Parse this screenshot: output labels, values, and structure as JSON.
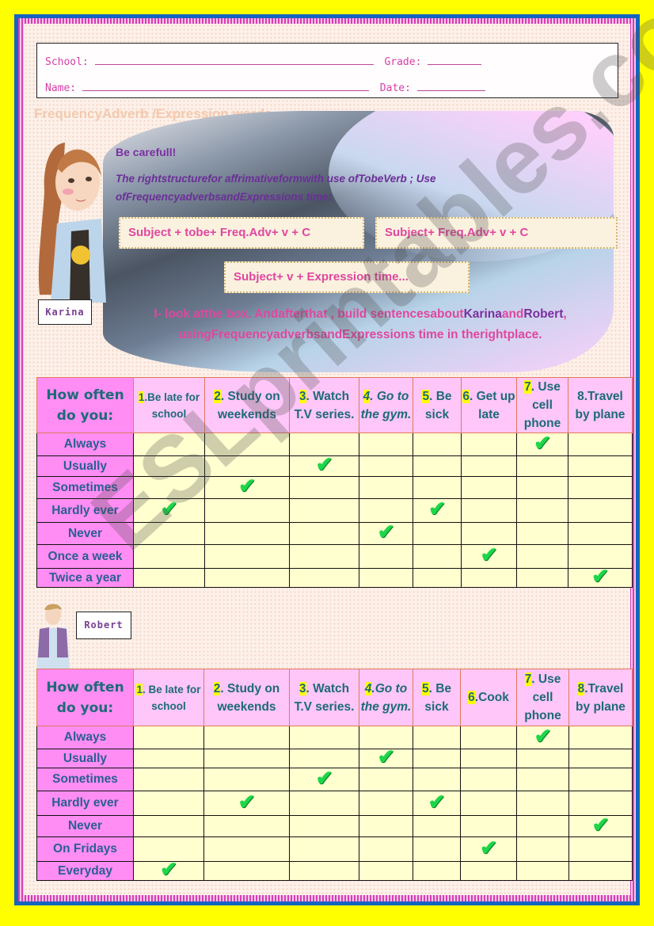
{
  "header": {
    "school_label": "School:",
    "grade_label": "Grade:",
    "name_label": "Name:",
    "date_label": "Date:"
  },
  "section_title": "FrequencyAdverb /Expression  words",
  "banner": {
    "be_careful": "Be carefull!",
    "structure_text": "The rightstructurefor affrimativeformwith use ofTobeVerb ;  Use ofFrequencyadverbsandExpressions time:",
    "formulas": [
      "Subject + tobe+  Freq.Adv+ v + C",
      "Subject+  Freq.Adv+ v + C",
      "Subject+  v +  Expression time..."
    ],
    "instruction": {
      "part1": "I- look atthe box. Andafterthat , build sentencesabout",
      "karina": "Karina",
      "and": "and",
      "robert": "Robert",
      "part2": ", usingFrequencyadverbsandExpressions  time in therightplace."
    }
  },
  "watermark": "ESLprintables.com",
  "check_symbol": "✔",
  "karina": {
    "name": "Karina",
    "corner_label": "How often do you:",
    "columns": [
      {
        "num": "1",
        "text": ".Be late for school"
      },
      {
        "num": "2",
        "text": ". Study on weekends"
      },
      {
        "num": "3",
        "text": ". Watch T.V series."
      },
      {
        "num": "4",
        "text": ". Go to the gym."
      },
      {
        "num": "5",
        "text": ". Be sick"
      },
      {
        "num": "6",
        "text": ". Get up late"
      },
      {
        "num": "7",
        "text": ". Use cell phone"
      },
      {
        "num": "",
        "text": "8.Travel by plane"
      }
    ],
    "rows": [
      {
        "label": "Always",
        "checked_col": 7
      },
      {
        "label": "Usually",
        "checked_col": 3
      },
      {
        "label": "Sometimes",
        "checked_col": 2
      },
      {
        "label": "Hardly ever",
        "checked_cols": [
          1,
          5
        ]
      },
      {
        "label": "Never",
        "checked_col": 4
      },
      {
        "label": "Once a week",
        "checked_col": 6
      },
      {
        "label": "Twice a year",
        "checked_col": 8
      }
    ]
  },
  "robert": {
    "name": "Robert",
    "corner_label": "How often do you:",
    "columns": [
      {
        "num": "1",
        "text": ". Be late for school"
      },
      {
        "num": "2",
        "text": ". Study on weekends"
      },
      {
        "num": "3",
        "text": ". Watch T.V series."
      },
      {
        "num": "4",
        "text": ".Go to the gym."
      },
      {
        "num": "5",
        "text": ". Be sick"
      },
      {
        "num": "6",
        "text": ".Cook"
      },
      {
        "num": "7",
        "text": ". Use cell phone"
      },
      {
        "num": "8",
        "text": ".Travel by plane"
      }
    ],
    "rows": [
      {
        "label": "Always",
        "checked_col": 7
      },
      {
        "label": "Usually",
        "checked_col": 4
      },
      {
        "label": "Sometimes",
        "checked_col": 3
      },
      {
        "label": "Hardly ever",
        "checked_cols": [
          2,
          5
        ]
      },
      {
        "label": "Never",
        "checked_col": 8
      },
      {
        "label": "On Fridays",
        "checked_col": 6
      },
      {
        "label": "Everyday",
        "checked_col": 1
      }
    ]
  }
}
